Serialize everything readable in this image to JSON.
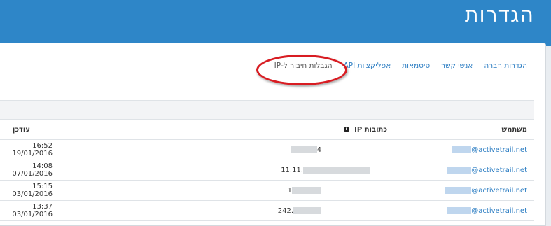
{
  "header": {
    "title": "הגדרות"
  },
  "tabs": [
    {
      "label": "הגדרות חברה",
      "active": false
    },
    {
      "label": "אנשי קשר",
      "active": false
    },
    {
      "label": "סיסמאות",
      "active": false
    },
    {
      "label": "אפליקציות API",
      "active": false
    },
    {
      "label": "הגבלות חיבור ל-IP",
      "active": true
    }
  ],
  "table": {
    "headers": {
      "user": "משתמש",
      "ip": "כתובות IP",
      "updated": "עודכן"
    },
    "rows": [
      {
        "user": "@activetrail.net",
        "ip": "4",
        "updated": "16:52 19/01/2016"
      },
      {
        "user": "@activetrail.net",
        "ip": "11.11.",
        "updated": "14:08 07/01/2016"
      },
      {
        "user": "@activetrail.net",
        "ip": "1",
        "updated": "15:15 03/01/2016"
      },
      {
        "user": "@activetrail.net",
        "ip": "242.",
        "updated": "13:37 03/01/2016"
      }
    ]
  },
  "colors": {
    "header": "#2e86c8",
    "link": "#2d7ec3",
    "highlight_ellipse": "#d81c22"
  }
}
